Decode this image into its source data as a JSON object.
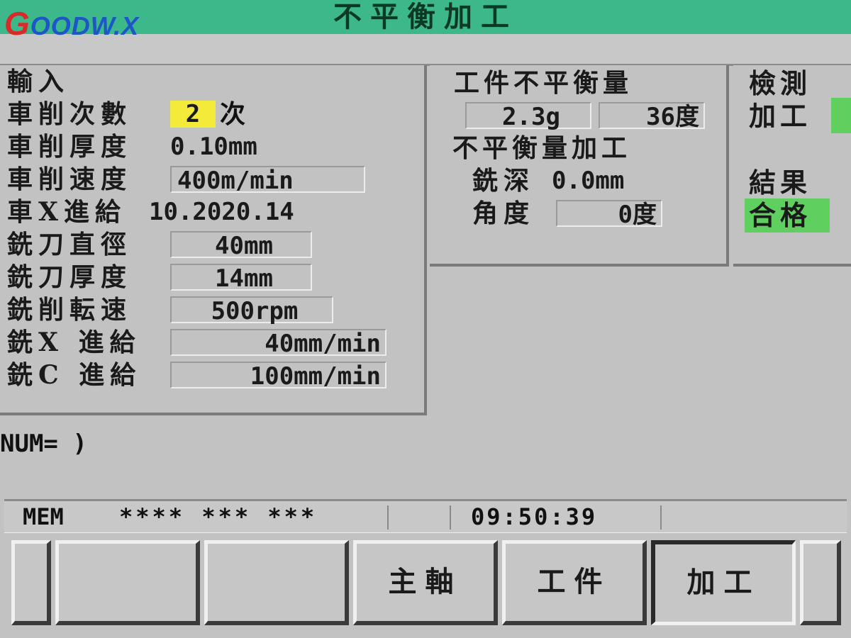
{
  "header": {
    "title": "不平衡加工",
    "logo_g": "G",
    "logo_rest": "OODW.X"
  },
  "input_panel": {
    "heading": "輸入",
    "rows": [
      {
        "label": "車削次數",
        "value": "2",
        "unit": "次"
      },
      {
        "label": "車削厚度",
        "value": "0.10mm"
      },
      {
        "label": "車削速度",
        "value": "400m/min"
      },
      {
        "label": "車X進給",
        "value": "10.2020.14"
      },
      {
        "label": "銑刀直徑",
        "value": "40mm"
      },
      {
        "label": "銑刀厚度",
        "value": "14mm"
      },
      {
        "label": "銑削転速",
        "value": "500rpm"
      },
      {
        "label": "銑X 進給",
        "value": "40mm/min"
      },
      {
        "label": "銑C 進給",
        "value": "100mm/min"
      }
    ]
  },
  "unbalance_panel": {
    "heading": "工件不平衡量",
    "amount": "2.3g",
    "angle": "36度",
    "process_heading": "不平衡量加工",
    "mill_depth_label": "銑深",
    "mill_depth_value": "0.0mm",
    "angle_label": "角度",
    "angle_value": "0度"
  },
  "status_panel": {
    "detect_label": "檢測",
    "process_label": "加工",
    "result_label": "結果",
    "result_value": "合格",
    "ok_color": "#5fcf5f"
  },
  "num_prompt": "NUM= )",
  "statusbar": {
    "mode": "MEM",
    "indicators": "**** *** ***",
    "time": "09:50:39"
  },
  "softkeys": {
    "spindle": "主軸",
    "workpiece": "工件",
    "process": "加工"
  },
  "colors": {
    "title_bar": "#3cb88a",
    "highlight": "#f3ea3a"
  }
}
